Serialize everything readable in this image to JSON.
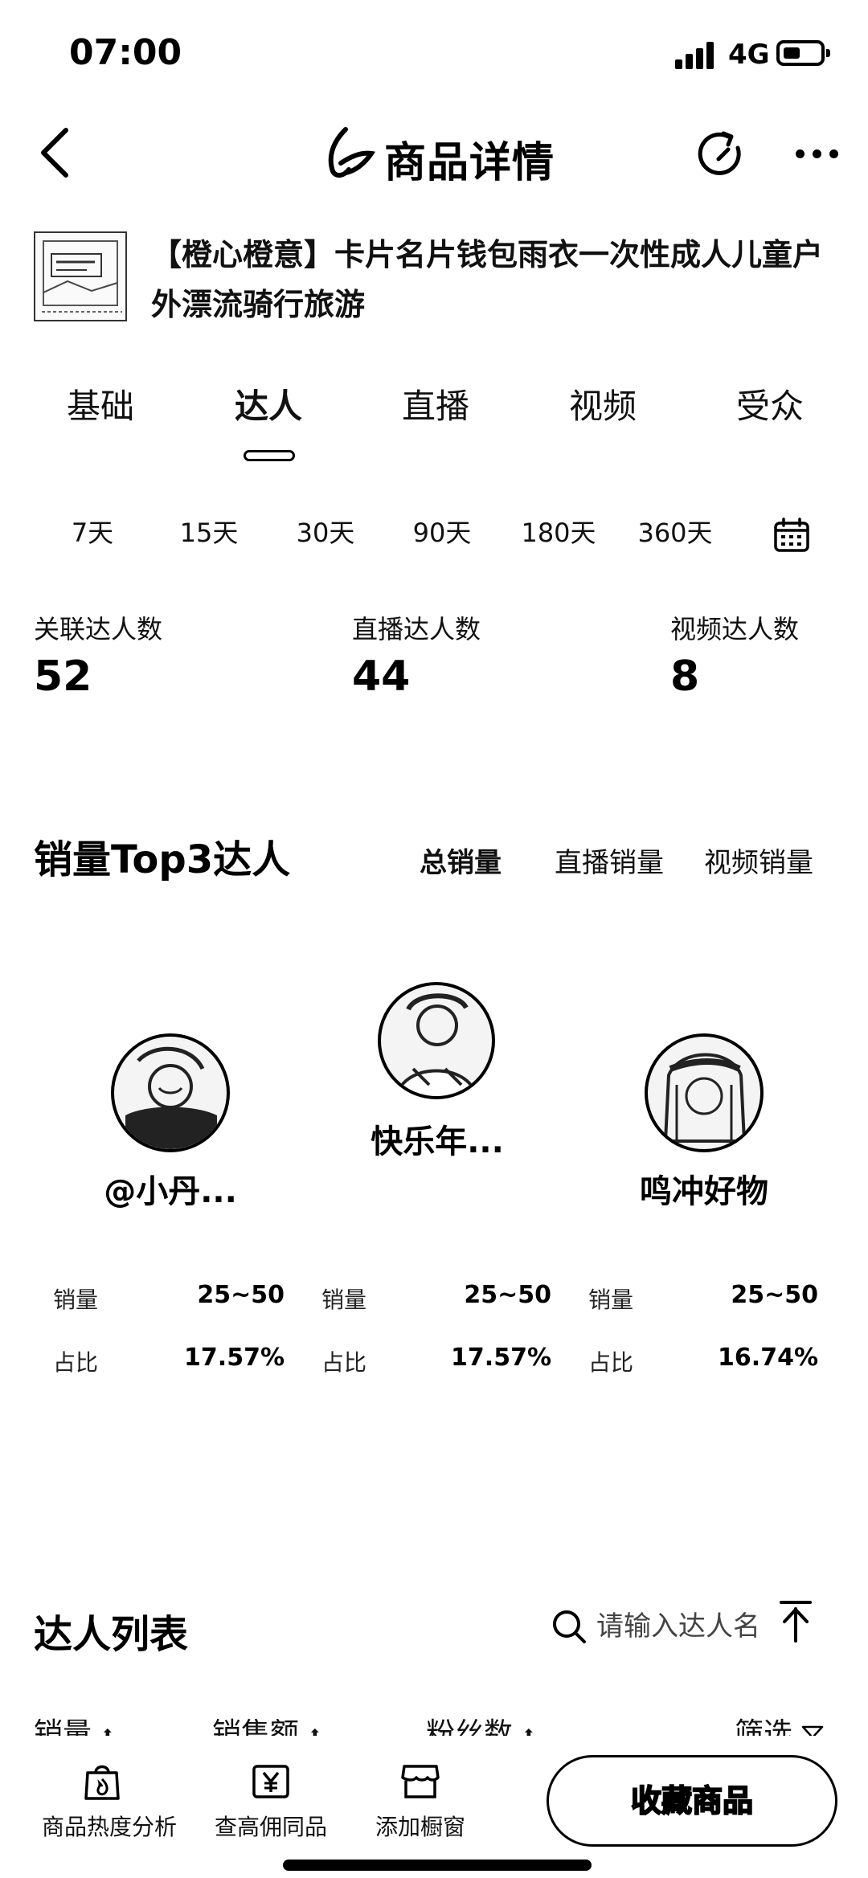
{
  "status_bar": {
    "time": "07:00",
    "network": "4G"
  },
  "header": {
    "title": "商品详情"
  },
  "product": {
    "title": "【橙心橙意】卡片名片钱包雨衣一次性成人儿童户外漂流骑行旅游"
  },
  "tabs": [
    {
      "label": "基础"
    },
    {
      "label": "达人",
      "active": true
    },
    {
      "label": "直播"
    },
    {
      "label": "视频"
    },
    {
      "label": "受众"
    }
  ],
  "time_filters": [
    "7天",
    "15天",
    "30天",
    "90天",
    "180天",
    "360天"
  ],
  "stats": [
    {
      "label": "关联达人数",
      "value": "52"
    },
    {
      "label": "直播达人数",
      "value": "44"
    },
    {
      "label": "视频达人数",
      "value": "8"
    }
  ],
  "top3": {
    "title": "销量Top3达人",
    "filters": [
      "总销量",
      "直播销量",
      "视频销量"
    ],
    "influencers": [
      {
        "name": "@小丹...",
        "sales_label": "销量",
        "sales": "25~50",
        "share_label": "占比",
        "share": "17.57%"
      },
      {
        "name": "快乐年...",
        "sales_label": "销量",
        "sales": "25~50",
        "share_label": "占比",
        "share": "17.57%"
      },
      {
        "name": "鸣冲好物",
        "sales_label": "销量",
        "sales": "25~50",
        "share_label": "占比",
        "share": "16.74%"
      }
    ]
  },
  "list": {
    "title": "达人列表",
    "search_placeholder": "请输入达人名",
    "sort": [
      "销量",
      "销售额",
      "粉丝数"
    ],
    "filter_label": "筛选"
  },
  "bottom_bar": {
    "items": [
      {
        "label": "商品热度分析",
        "icon": "hot-bag-icon"
      },
      {
        "label": "查高佣同品",
        "icon": "yen-icon"
      },
      {
        "label": "添加橱窗",
        "icon": "shop-icon"
      }
    ],
    "collect_label": "收藏商品"
  }
}
